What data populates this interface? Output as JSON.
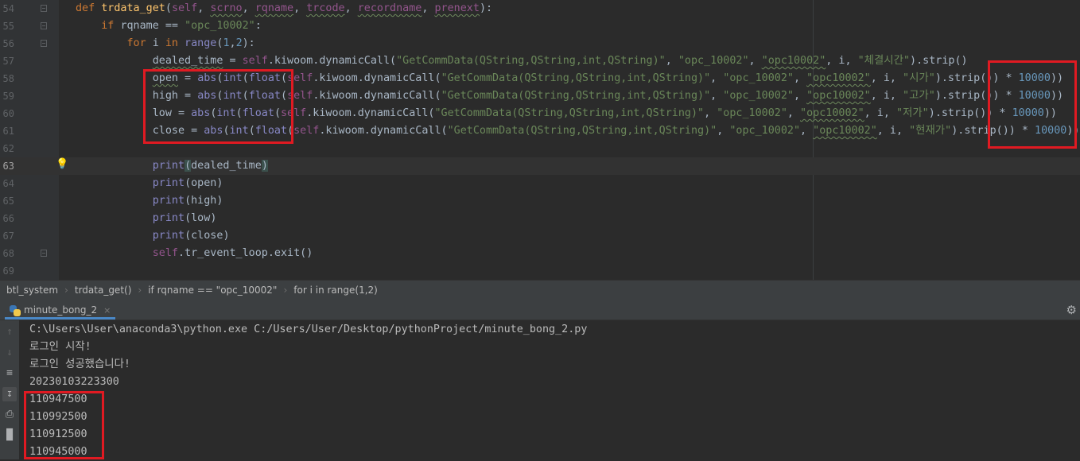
{
  "editor": {
    "line_numbers": [
      "54",
      "55",
      "56",
      "57",
      "58",
      "59",
      "60",
      "61",
      "62",
      "63",
      "64",
      "65",
      "66",
      "67",
      "68",
      "69"
    ],
    "line54": {
      "def": "def",
      "name": "trdata_get",
      "p1": "self",
      "p2": "scrno",
      "p3": "rqname",
      "p4": "trcode",
      "p5": "recordname",
      "p6": "prenext"
    },
    "line55": {
      "if": "if",
      "var": "rqname",
      "op": " == ",
      "str": "\"opc_10002\"",
      "end": ":"
    },
    "line56": {
      "for": "for",
      "var": " i ",
      "in": "in",
      "fn": " range",
      "a": "1",
      "b": "2"
    },
    "call_args": {
      "getcomm": "\"GetCommData(QString,QString,int,QString)\"",
      "code": "\"opc_10002\"",
      "rec": "\"opc10002\""
    },
    "line57": {
      "var": "dealed_time",
      "field": "\"체결시간\""
    },
    "line58": {
      "var": "open",
      "field": "\"시가\"",
      "mult": "10000"
    },
    "line59": {
      "var": "high",
      "field": "\"고가\"",
      "mult": "10000"
    },
    "line60": {
      "var": "low",
      "field": "\"저가\"",
      "mult": "10000"
    },
    "line61": {
      "var": "close",
      "field": "\"현재가\"",
      "mult": "10000"
    },
    "line63": {
      "arg": "dealed_time"
    },
    "line64": {
      "arg": "open"
    },
    "line65": {
      "arg": "high"
    },
    "line66": {
      "arg": "low"
    },
    "line67": {
      "arg": "close"
    },
    "line68": {
      "text": ".tr_event_loop.exit()"
    },
    "tokens": {
      "self": "self",
      "kiwoom": ".kiwoom.dynamicCall(",
      "abs": "abs",
      "int": "int",
      "float": "float",
      "print": "print",
      "strip": ".strip()",
      "i": " i"
    }
  },
  "breadcrumb": [
    "btl_system",
    "trdata_get()",
    "if rqname == \"opc_10002\"",
    "for i in range(1,2)"
  ],
  "run_tab": {
    "label": "minute_bong_2",
    "close": "×"
  },
  "console": {
    "lines": [
      "C:\\Users\\User\\anaconda3\\python.exe C:/Users/User/Desktop/pythonProject/minute_bong_2.py",
      "로그인 시작!",
      "로그인 성공했습니다!",
      "20230103223300",
      "110947500",
      "110992500",
      "110912500",
      "110945000"
    ]
  },
  "icons": {
    "settings": "gear-icon",
    "up": "arrow-up-icon",
    "down": "arrow-down-icon",
    "wrap": "soft-wrap-icon",
    "scroll": "scroll-to-end-icon",
    "print": "print-icon",
    "trash": "trash-icon",
    "bulb": "lightbulb-icon",
    "python": "python-icon"
  },
  "colors": {
    "highlight_box": "#e01a22",
    "keyword": "#cc7832",
    "string": "#6a8759",
    "number": "#6897bb",
    "self": "#94558d",
    "function": "#ffc66d"
  }
}
